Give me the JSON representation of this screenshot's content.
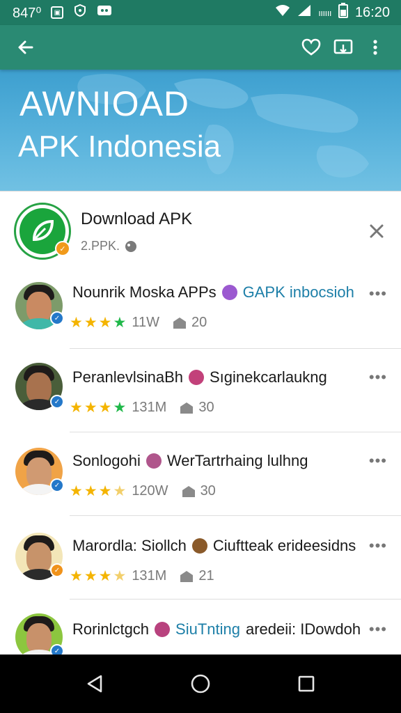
{
  "status_bar": {
    "left_text": "847⁰",
    "network_label": "ıııııı",
    "time": "16:20"
  },
  "app_bar": {
    "back_icon": "arrow-left-icon",
    "actions": [
      "heart-icon",
      "cast-icon",
      "more-vert-icon"
    ]
  },
  "banner": {
    "line1": "AWNIOAD",
    "line2": "APK Indonesia"
  },
  "app": {
    "title": "Download APK",
    "subtitle": "2.PPK.",
    "logo_color": "#1aa53c"
  },
  "items": [
    {
      "name": "Nounrik Moska APPs",
      "tag": "GAPK inbocsioh",
      "rating_count": "11W",
      "installs": "20",
      "verified_color": "#2478c9"
    },
    {
      "name": "PeranlevlsinaBh",
      "tag": "Sıginekcarlaukng",
      "rating_count": "131M",
      "installs": "30",
      "verified_color": "#2478c9"
    },
    {
      "name": "Sonlogohi",
      "tag": "WerTartrhaing lulhng",
      "rating_count": "120W",
      "installs": "30",
      "verified_color": "#2478c9"
    },
    {
      "name": "Marordla: Siollch",
      "tag": "Ciuftteak erideesidns",
      "rating_count": "131M",
      "installs": "21",
      "verified_color": "#f0921a"
    },
    {
      "name": "Rorinlctgch",
      "tag": "SiuTnting",
      "tag2": "aredeii: IDowdoh",
      "verified_color": "#2478c9"
    }
  ],
  "colors": {
    "status_bar": "#1f7a63",
    "app_bar": "#2a8a73",
    "banner": "#4aa8d5",
    "link": "#1d7fa8",
    "star": "#f4b400"
  }
}
